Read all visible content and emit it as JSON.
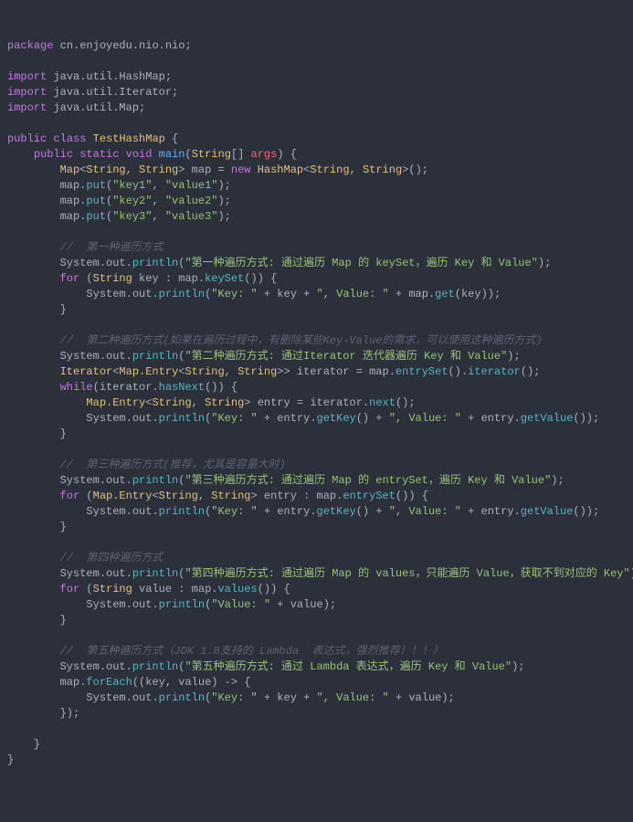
{
  "code": {
    "package_kw": "package",
    "package_name": "cn.enjoyedu.nio.nio",
    "import_kw": "import",
    "imports": [
      "java.util.HashMap",
      "java.util.Iterator",
      "java.util.Map"
    ],
    "public_kw": "public",
    "class_kw": "class",
    "static_kw": "static",
    "void_kw": "void",
    "new_kw": "new",
    "for_kw": "for",
    "while_kw": "while",
    "class_name": "TestHashMap",
    "main": "main",
    "string_type": "String",
    "map_type": "Map",
    "hashmap_type": "HashMap",
    "iterator_type": "Iterator",
    "entry_type": "Map.Entry",
    "args": "args",
    "map_var": "map",
    "key_var": "key",
    "value_var": "value",
    "iterator_var": "iterator",
    "entry_var": "entry",
    "put": "put",
    "println": "println",
    "keySet": "keySet",
    "get": "get",
    "entrySet": "entrySet",
    "iterator_m": "iterator",
    "hasNext": "hasNext",
    "next": "next",
    "getKey": "getKey",
    "getValue": "getValue",
    "values": "values",
    "forEach": "forEach",
    "system_out": "System.out",
    "s_key1": "\"key1\"",
    "s_value1": "\"value1\"",
    "s_key2": "\"key2\"",
    "s_value2": "\"value2\"",
    "s_key3": "\"key3\"",
    "s_value3": "\"value3\"",
    "c1": "//  第一种遍历方式",
    "p1": "\"第一种遍历方式: 通过遍历 Map 的 keySet，遍历 Key 和 Value\"",
    "s_key": "\"Key: \"",
    "s_value": "\", Value: \"",
    "c2": "//  第二种遍历方式(如果在遍历过程中，有删除某些Key-Value的需求，可以使用这种遍历方式)",
    "p2": "\"第二种遍历方式: 通过Iterator 迭代器遍历 Key 和 Value\"",
    "c3": "//  第三种遍历方式(推荐，尤其是容量大时)",
    "p3": "\"第三种遍历方式: 通过遍历 Map 的 entrySet，遍历 Key 和 Value\"",
    "c4": "//  第四种遍历方式",
    "p4": "\"第四种遍历方式: 通过遍历 Map 的 values，只能遍历 Value，获取不到对应的 Key\"",
    "s_valueonly": "\"Value: \"",
    "c5": "//  第五种遍历方式（JDK 1.8支持的 Lambda  表达式，强烈推荐！！！）",
    "p5": "\"第五种遍历方式: 通过 Lambda 表达式，遍历 Key 和 Value\""
  }
}
